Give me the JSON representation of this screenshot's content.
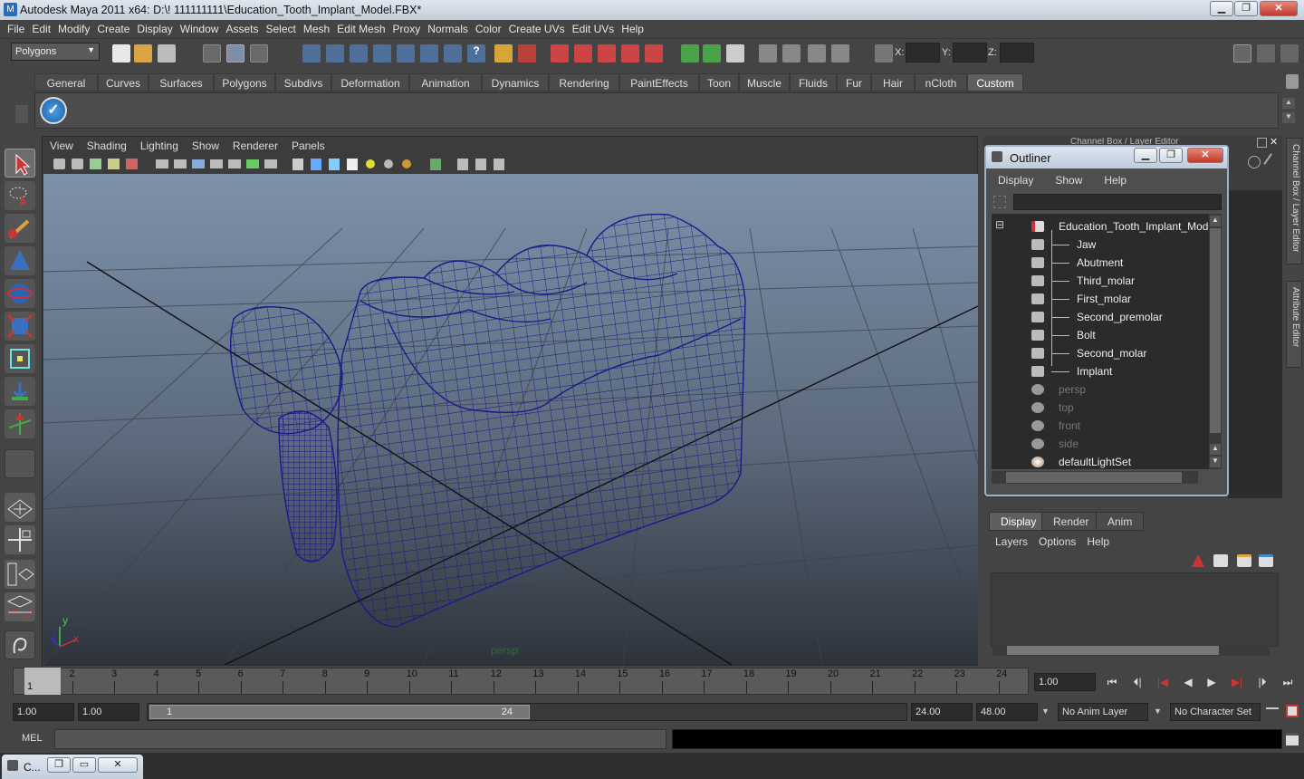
{
  "window": {
    "title": "Autodesk Maya 2011 x64: D:\\! 111111111\\Education_Tooth_Implant_Model.FBX*",
    "minimize": "▁",
    "maximize": "❐",
    "close": "✕"
  },
  "menubar": [
    "File",
    "Edit",
    "Modify",
    "Create",
    "Display",
    "Window",
    "Assets",
    "Select",
    "Mesh",
    "Edit Mesh",
    "Proxy",
    "Normals",
    "Color",
    "Create UVs",
    "Edit UVs",
    "Help"
  ],
  "statusline": {
    "mode_select": "Polygons",
    "x_label": "X:",
    "y_label": "Y:",
    "z_label": "Z:"
  },
  "shelf": {
    "tabs": [
      "General",
      "Curves",
      "Surfaces",
      "Polygons",
      "Subdivs",
      "Deformation",
      "Animation",
      "Dynamics",
      "Rendering",
      "PaintEffects",
      "Toon",
      "Muscle",
      "Fluids",
      "Fur",
      "Hair",
      "nCloth",
      "Custom"
    ],
    "active_tab": "Custom"
  },
  "viewport": {
    "menu": [
      "View",
      "Shading",
      "Lighting",
      "Show",
      "Renderer",
      "Panels"
    ],
    "camera_label": "persp",
    "axis_x": "x",
    "axis_y": "y",
    "axis_z": "z",
    "wire_color": "#1a1a8c"
  },
  "channel_box": {
    "title": "Channel Box / Layer Editor",
    "side_tab_1": "Channel Box / Layer Editor",
    "side_tab_2": "Attribute Editor"
  },
  "outliner": {
    "title": "Outliner",
    "menu": [
      "Display",
      "Show",
      "Help"
    ],
    "root": "Education_Tooth_Implant_Model",
    "children": [
      "Jaw",
      "Abutment",
      "Third_molar",
      "First_molar",
      "Second_premolar",
      "Bolt",
      "Second_molar",
      "Implant"
    ],
    "cameras": [
      "persp",
      "top",
      "front",
      "side"
    ],
    "sets": [
      "defaultLightSet"
    ]
  },
  "layer_editor": {
    "tabs": [
      "Display",
      "Render",
      "Anim"
    ],
    "active_tab": "Display",
    "menu": [
      "Layers",
      "Options",
      "Help"
    ]
  },
  "timeline": {
    "ticks": [
      "1",
      "2",
      "3",
      "4",
      "5",
      "6",
      "7",
      "8",
      "9",
      "10",
      "11",
      "12",
      "13",
      "14",
      "15",
      "16",
      "17",
      "18",
      "19",
      "20",
      "21",
      "22",
      "23",
      "24"
    ],
    "current_frame_marker": "1",
    "current_time": "1.00"
  },
  "range": {
    "start_time": "1.00",
    "playback_start": "1.00",
    "slider_start": "1",
    "slider_end": "24",
    "playback_end": "24.00",
    "end_time": "48.00",
    "anim_layer": "No Anim Layer",
    "character_set": "No Character Set"
  },
  "mel": {
    "label": "MEL"
  },
  "taskbar": {
    "item_label": "C..."
  }
}
